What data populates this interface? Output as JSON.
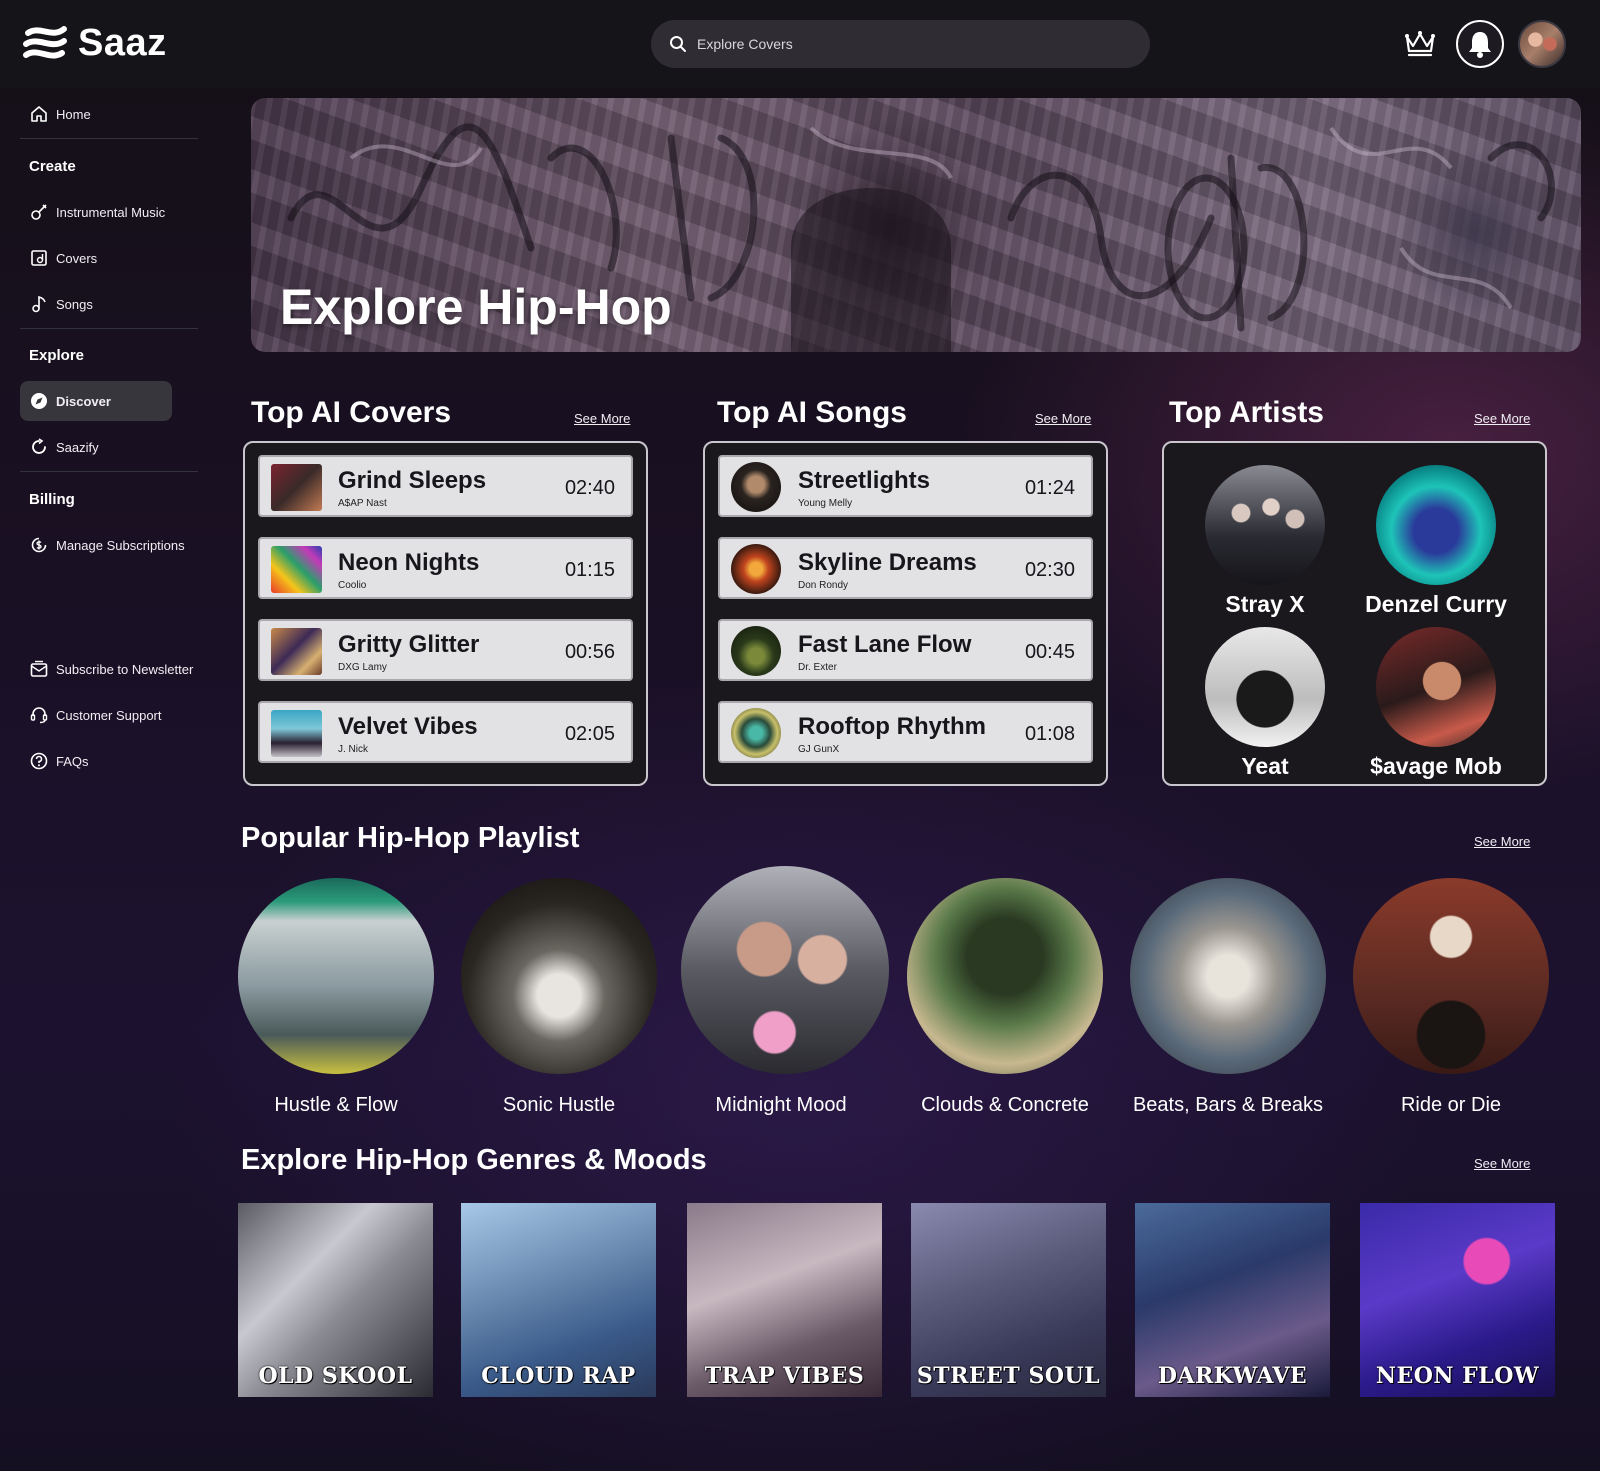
{
  "app": {
    "name": "Saaz"
  },
  "search": {
    "placeholder": "Explore Covers"
  },
  "sidebar": {
    "home": "Home",
    "create_heading": "Create",
    "create_items": [
      "Instrumental Music",
      "Covers",
      "Songs"
    ],
    "explore_heading": "Explore",
    "explore_items": [
      "Discover",
      "Saazify"
    ],
    "billing_heading": "Billing",
    "billing_items": [
      "Manage Subscriptions"
    ],
    "footer_items": [
      "Subscribe to Newsletter",
      "Customer Support",
      "FAQs"
    ]
  },
  "hero": {
    "title": "Explore Hip-Hop"
  },
  "sections": {
    "see_more": "See More",
    "top_covers": "Top AI Covers",
    "top_songs": "Top AI Songs",
    "top_artists": "Top Artists",
    "playlists": "Popular Hip-Hop Playlist",
    "genres": "Explore Hip-Hop Genres & Moods"
  },
  "top_covers": [
    {
      "title": "Grind Sleeps",
      "artist": "A$AP Nast",
      "duration": "02:40"
    },
    {
      "title": "Neon Nights",
      "artist": "Coolio",
      "duration": "01:15"
    },
    {
      "title": "Gritty Glitter",
      "artist": "DXG Lamy",
      "duration": "00:56"
    },
    {
      "title": "Velvet Vibes",
      "artist": "J. Nick",
      "duration": "02:05"
    }
  ],
  "top_songs": [
    {
      "title": "Streetlights",
      "artist": "Young Melly",
      "duration": "01:24"
    },
    {
      "title": "Skyline Dreams",
      "artist": "Don Rondy",
      "duration": "02:30"
    },
    {
      "title": "Fast Lane Flow",
      "artist": "Dr. Exter",
      "duration": "00:45"
    },
    {
      "title": "Rooftop Rhythm",
      "artist": "GJ GunX",
      "duration": "01:08"
    }
  ],
  "top_artists": [
    "Stray X",
    "Denzel Curry",
    "Yeat",
    "$avage Mob"
  ],
  "playlists": [
    "Hustle & Flow",
    "Sonic Hustle",
    "Midnight Mood",
    "Clouds & Concrete",
    "Beats, Bars & Breaks",
    "Ride or Die"
  ],
  "genres": [
    "OLD SKOOL",
    "CLOUD RAP",
    "TRAP VIBES",
    "STREET SOUL",
    "DARKWAVE",
    "NEON FLOW"
  ]
}
